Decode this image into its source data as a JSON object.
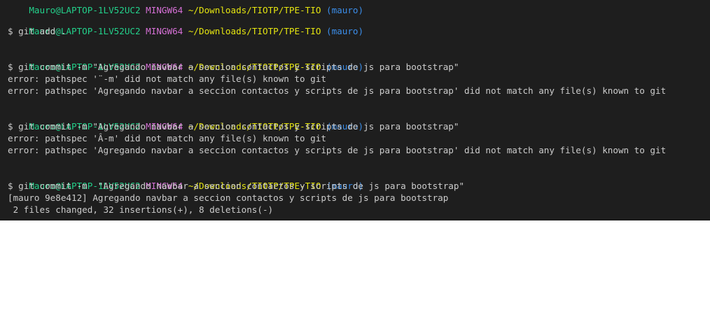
{
  "terminal": {
    "prompt": {
      "user_host": "Mauro@LAPTOP-1LV52UC2",
      "env": "MINGW64",
      "path": "~/Downloads/TIOTP/TPE-TIO",
      "branch": "(mauro)"
    },
    "top_partial": "Mauro@LAPTOP-1LV52UC2 MINGW64 ~/Downloads/TIOTP/TPE-TIO (mauro)",
    "blocks": [
      {
        "command": "$ git add .",
        "output": []
      },
      {
        "command": "$ git commit -m \"Agregando navbar a seccion contactos y scripts de js para bootstrap\"",
        "output": [
          "error: pathspec '¨-m' did not match any file(s) known to git",
          "error: pathspec 'Agregando navbar a seccion contactos y scripts de js para bootstrap' did not match any file(s) known to git"
        ]
      },
      {
        "command": "$ git commit -m \"Agregando navbar a seccion contactos y scripts de js para bootstrap\"",
        "output": [
          "error: pathspec 'Â-m' did not match any file(s) known to git",
          "error: pathspec 'Agregando navbar a seccion contactos y scripts de js para bootstrap' did not match any file(s) known to git"
        ]
      },
      {
        "command": "$ git commit -m  \"Agregando navbar a seccion contactos y scripts de js para bootstrap\"",
        "output": [
          "[mauro 9e8e412] Agregando navbar a seccion contactos y scripts de js para bootstrap",
          " 2 files changed, 32 insertions(+), 8 deletions(-)"
        ]
      }
    ]
  },
  "colors": {
    "background": "#1e1e1e",
    "user_host": "#23d18b",
    "env": "#d670d6",
    "path": "#e5e510",
    "branch": "#3b8eea",
    "text": "#cccccc"
  }
}
